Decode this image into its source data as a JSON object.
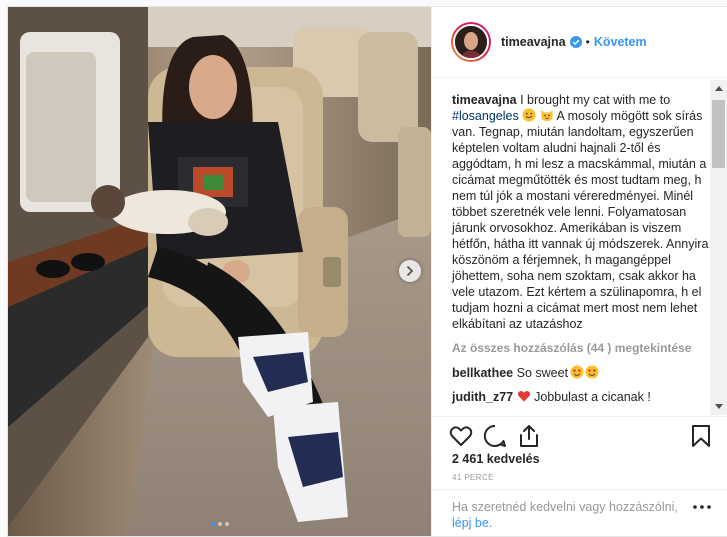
{
  "post": {
    "username": "timeavajna",
    "follow_label": "Követem",
    "separator": "•",
    "caption_text_1": " I brought my cat with me to ",
    "hashtag": "#losangeles",
    "caption_text_2": " A mosoly mögött sok sírás van. Tegnap, miután landoltam, egyszerűen képtelen voltam aludni hajnali 2-től és aggódtam, h mi lesz a macskámmal, miután a cicámat megműtötték és most tudtam meg, h nem túl jók a mostani vérered­ményei. Minél többet szeretnék vele lenni. Folyamatosan járunk orvosokhoz. Amerikában is viszem hétfőn, hátha itt vannak új módszerek. Annyira köszönöm a férjemnek, h magangéppel jöhettem, soha nem szoktam, csak akkor ha vele utazom. Ezt kértem a szülinapomra, h el tudjam hozni a cicámat mert most nem lehet elkábítani az utazáshoz",
    "view_all_comments": "Az összes hozzászólás (44 ) megtekintése",
    "comments": [
      {
        "user": "bellkathee",
        "text": "So sweet"
      },
      {
        "user": "judith_z77",
        "text": "Jobbulast a cicanak !"
      }
    ],
    "likes": "2 461 kedvelés",
    "time_ago": "41 PERCE",
    "login_prompt": "Ha szeretnéd kedvelni vagy hozzászólni,",
    "login_link": "lépj be.",
    "carousel": {
      "count": 3,
      "active_index": 0
    }
  },
  "icons": {
    "verified": "verified-badge-icon",
    "like": "heart-icon",
    "comment": "comment-bubble-icon",
    "share": "share-icon",
    "save": "bookmark-icon",
    "more": "more-dots-icon",
    "next": "chevron-right-icon"
  },
  "colors": {
    "link_blue": "#3897f0",
    "hashtag_blue": "#003569",
    "muted_gray": "#999999",
    "text": "#262626"
  }
}
